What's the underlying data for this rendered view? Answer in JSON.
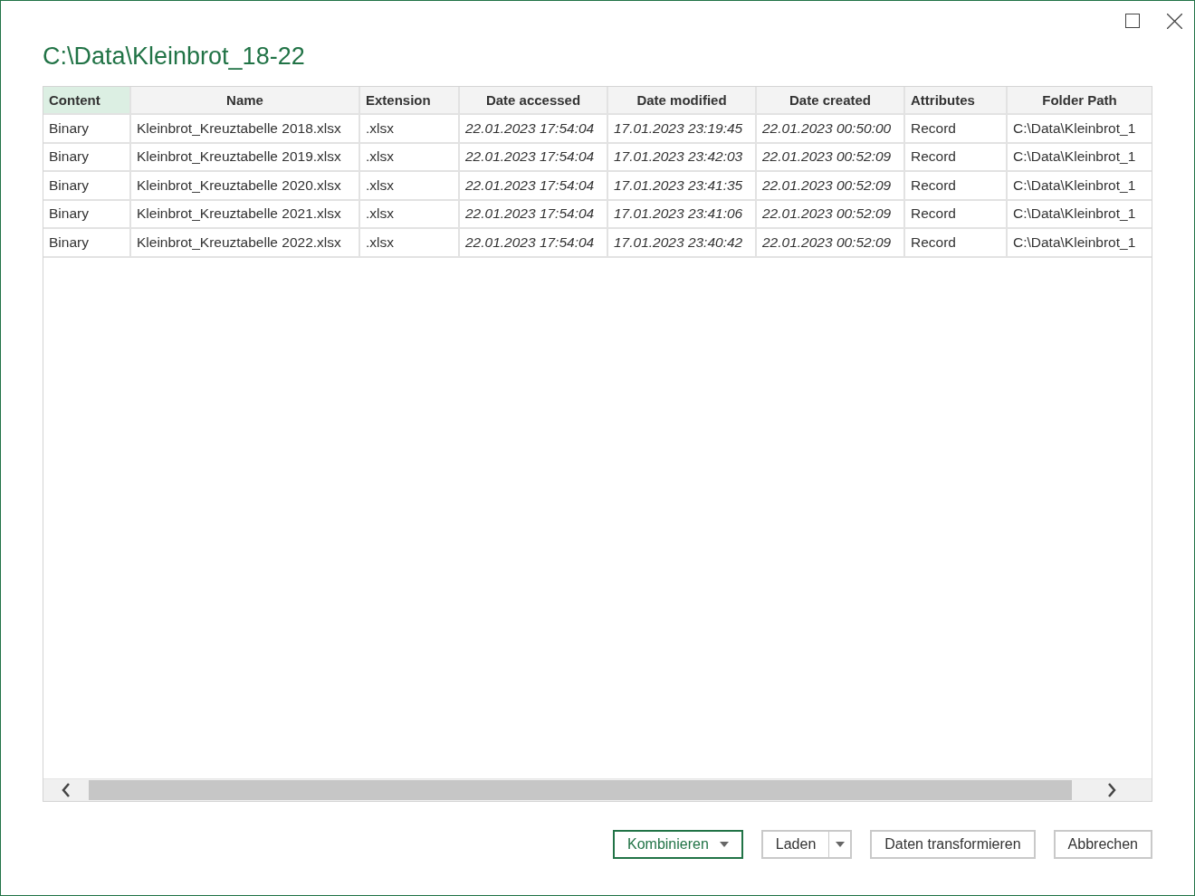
{
  "window": {
    "title": "C:\\Data\\Kleinbrot_18-22"
  },
  "table": {
    "columns": [
      {
        "label": "Content",
        "kind": "plain",
        "selected": true
      },
      {
        "label": "Name",
        "kind": "centered",
        "selected": false
      },
      {
        "label": "Extension",
        "kind": "plain",
        "selected": false
      },
      {
        "label": "Date accessed",
        "kind": "datetime",
        "selected": false
      },
      {
        "label": "Date modified",
        "kind": "datetime",
        "selected": false
      },
      {
        "label": "Date created",
        "kind": "datetime",
        "selected": false
      },
      {
        "label": "Attributes",
        "kind": "plain",
        "selected": false
      },
      {
        "label": "Folder Path",
        "kind": "centered",
        "selected": false
      }
    ],
    "rows": [
      [
        "Binary",
        "Kleinbrot_Kreuztabelle 2018.xlsx",
        ".xlsx",
        "22.01.2023 17:54:04",
        "17.01.2023 23:19:45",
        "22.01.2023 00:50:00",
        "Record",
        "C:\\Data\\Kleinbrot_1"
      ],
      [
        "Binary",
        "Kleinbrot_Kreuztabelle 2019.xlsx",
        ".xlsx",
        "22.01.2023 17:54:04",
        "17.01.2023 23:42:03",
        "22.01.2023 00:52:09",
        "Record",
        "C:\\Data\\Kleinbrot_1"
      ],
      [
        "Binary",
        "Kleinbrot_Kreuztabelle 2020.xlsx",
        ".xlsx",
        "22.01.2023 17:54:04",
        "17.01.2023 23:41:35",
        "22.01.2023 00:52:09",
        "Record",
        "C:\\Data\\Kleinbrot_1"
      ],
      [
        "Binary",
        "Kleinbrot_Kreuztabelle 2021.xlsx",
        ".xlsx",
        "22.01.2023 17:54:04",
        "17.01.2023 23:41:06",
        "22.01.2023 00:52:09",
        "Record",
        "C:\\Data\\Kleinbrot_1"
      ],
      [
        "Binary",
        "Kleinbrot_Kreuztabelle 2022.xlsx",
        ".xlsx",
        "22.01.2023 17:54:04",
        "17.01.2023 23:40:42",
        "22.01.2023 00:52:09",
        "Record",
        "C:\\Data\\Kleinbrot_1"
      ]
    ]
  },
  "buttons": [
    {
      "label": "Kombinieren",
      "kind": "primary-dropdown"
    },
    {
      "label": "Laden",
      "kind": "split"
    },
    {
      "label": "Daten transformieren",
      "kind": "plain"
    },
    {
      "label": "Abbrechen",
      "kind": "plain"
    }
  ]
}
